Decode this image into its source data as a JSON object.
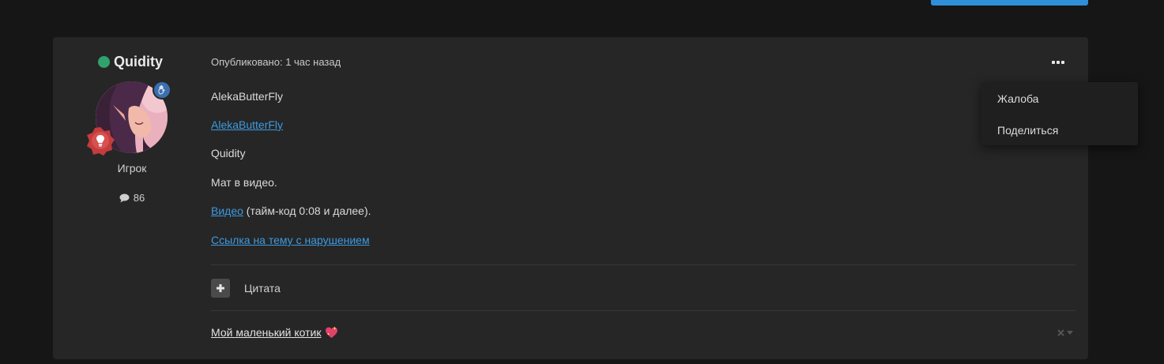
{
  "post": {
    "author": {
      "name": "Quidity",
      "rank": "Игрок",
      "post_count": "86",
      "online_color": "#2fa36b"
    },
    "meta": "Опубликовано: 1 час назад",
    "content": {
      "line1": "AlekaButterFly",
      "line2_link": "AlekaButterFly",
      "line3": "Quidity",
      "line4": "Мат в видео.",
      "line5_link": "Видео",
      "line5_rest": " (тайм-код 0:08 и далее).",
      "line6_link": "Ссылка на тему с нарушением"
    },
    "quote_label": "Цитата",
    "signature": "Мой маленький котик",
    "accent_color": "#3d9ae0"
  },
  "menu": {
    "items": [
      {
        "label": "Жалоба"
      },
      {
        "label": "Поделиться"
      }
    ]
  },
  "icons": {
    "more": "ellipsis-icon",
    "hand_badge": "hand-icon",
    "bulb_badge": "lightbulb-icon",
    "comment": "comment-icon",
    "plus": "plus-icon",
    "heart": "sparkling-heart-icon",
    "close": "close-icon",
    "caret": "caret-down-icon"
  }
}
